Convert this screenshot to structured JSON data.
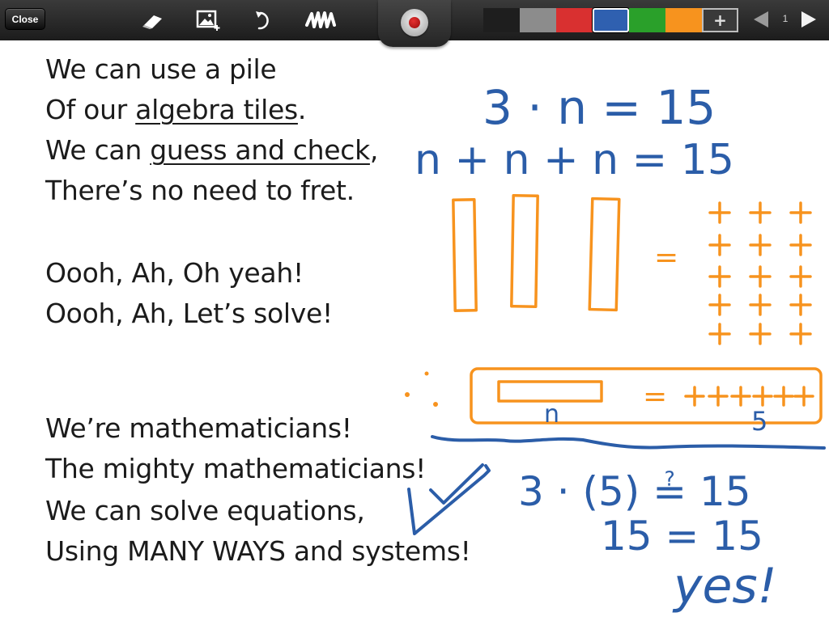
{
  "toolbar": {
    "close_label": "Close",
    "tools": [
      "eraser-icon",
      "insert-image-icon",
      "undo-icon",
      "clear-scribble-icon"
    ],
    "record_icon": "record-icon",
    "colors": [
      "#1e1e1e",
      "#8c8c8c",
      "#d93030",
      "#2f60b0",
      "#2aa02a",
      "#f7931e"
    ],
    "selected_color": "#2f60b0",
    "add_color_label": "+",
    "page_number": "1"
  },
  "song": {
    "verse1": [
      "We can use a pile",
      "Of our",
      "algebra tiles",
      ".",
      "We can",
      "guess and check",
      ",",
      "There’s no need to fret."
    ],
    "chorus": [
      "Oooh, Ah, Oh yeah!",
      "Oooh, Ah, Let’s solve!"
    ],
    "verse2": [
      "We’re mathematicians!",
      "The mighty mathematicians!",
      "We can solve equations,",
      "Using MANY WAYS and systems!"
    ]
  },
  "ink": {
    "eq1": "3 · n = 15",
    "eq2": "n + n + n = 15",
    "tile_label": "n",
    "unit_count": "5",
    "check1": "3 · (5) ≟ 15",
    "check2": "15 = 15",
    "exclaim": "yes!"
  }
}
